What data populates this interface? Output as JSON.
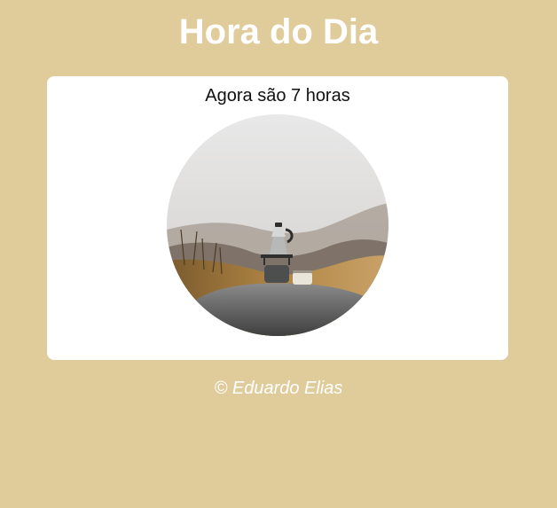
{
  "header": {
    "title": "Hora do Dia"
  },
  "card": {
    "time_text": "Agora são 7 horas",
    "image_subject": "morning-coffee-photo"
  },
  "footer": {
    "copyright": "© Eduardo Elias"
  },
  "colors": {
    "page_background": "#e0cb9b",
    "card_background": "#ffffff",
    "title_text": "#ffffff",
    "footer_text": "#ffffff"
  }
}
